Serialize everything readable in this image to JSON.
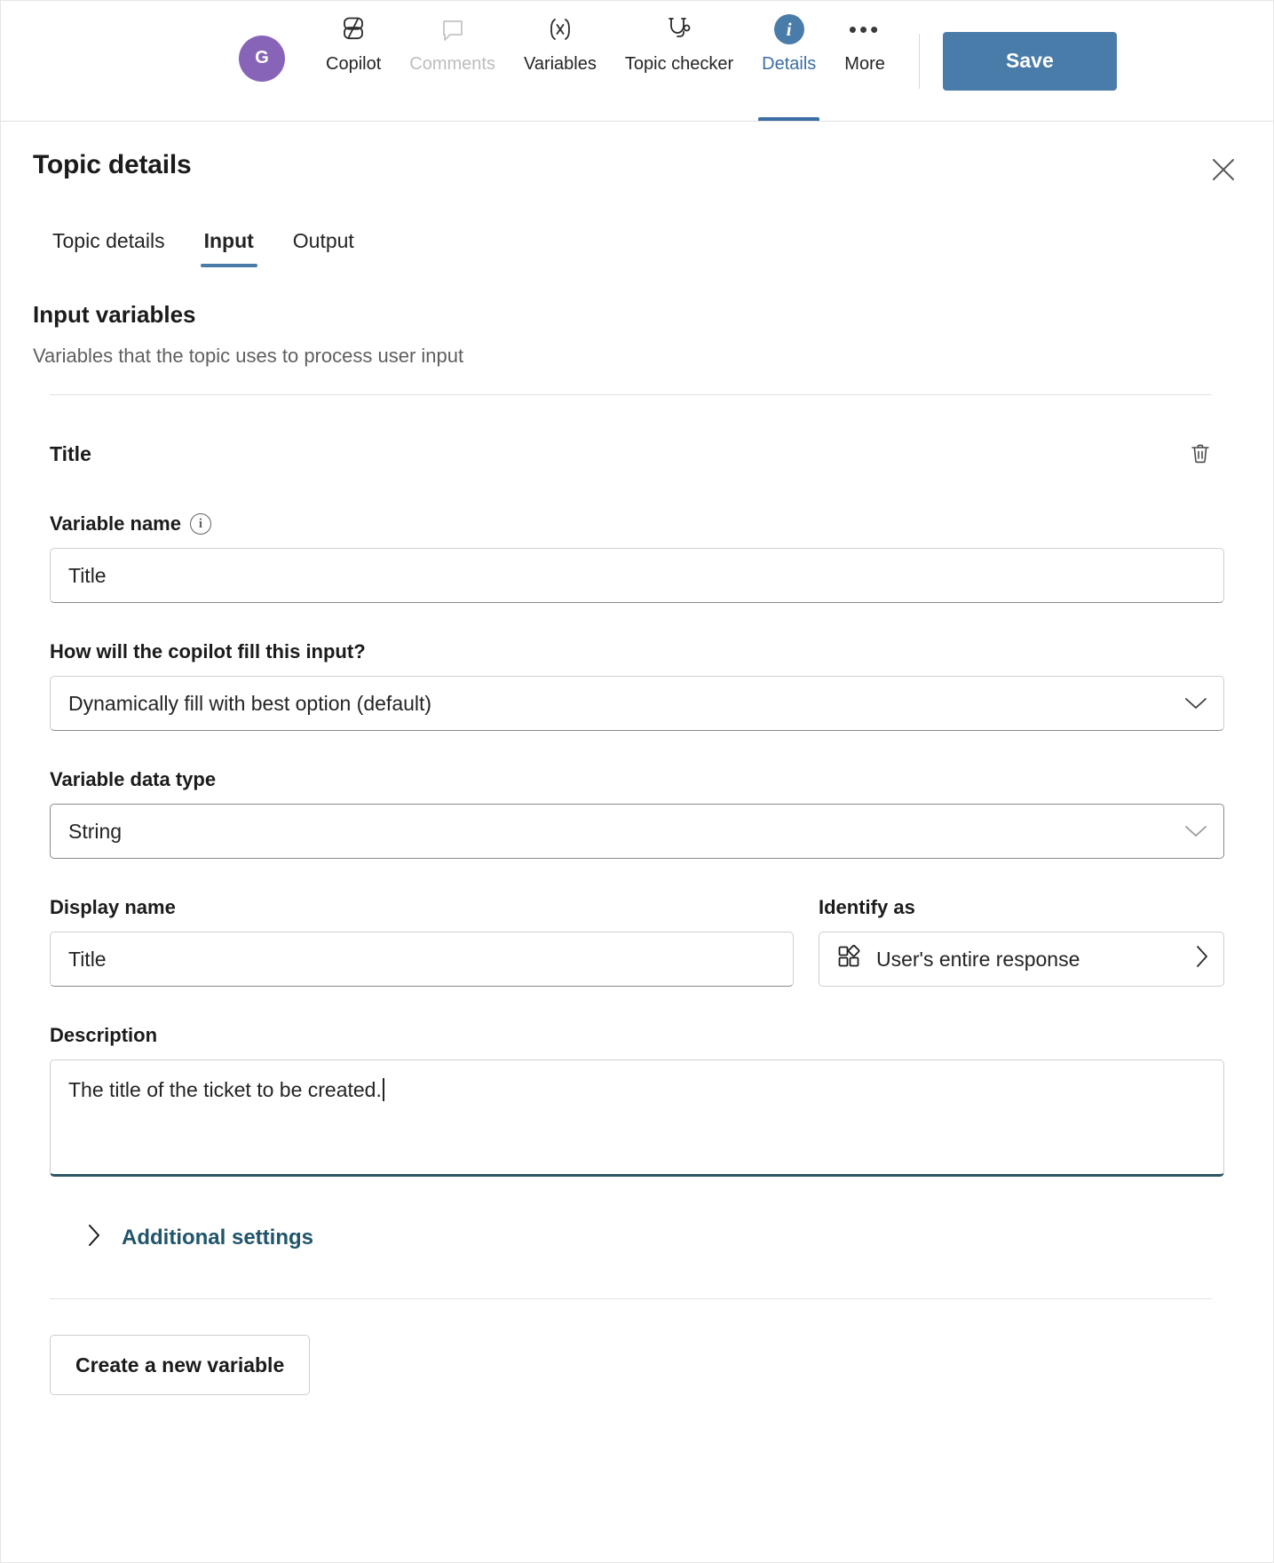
{
  "toolbar": {
    "avatar_initial": "G",
    "avatar_color": "#8764b8",
    "accent_color": "#4a7caa",
    "items": [
      {
        "label": "Copilot",
        "icon": "copilot-icon",
        "state": "normal"
      },
      {
        "label": "Comments",
        "icon": "comment-icon",
        "state": "disabled"
      },
      {
        "label": "Variables",
        "icon": "variables-icon",
        "state": "normal"
      },
      {
        "label": "Topic checker",
        "icon": "stethoscope-icon",
        "state": "normal"
      },
      {
        "label": "Details",
        "icon": "info-circle-icon",
        "state": "active"
      },
      {
        "label": "More",
        "icon": "ellipsis-icon",
        "state": "normal"
      }
    ],
    "save_label": "Save"
  },
  "panel": {
    "title": "Topic details",
    "close_label": "Close",
    "tabs": [
      {
        "label": "Topic details",
        "selected": false
      },
      {
        "label": "Input",
        "selected": true
      },
      {
        "label": "Output",
        "selected": false
      }
    ]
  },
  "section": {
    "heading": "Input variables",
    "subheading": "Variables that the topic uses to process user input"
  },
  "variable": {
    "name_header": "Title",
    "delete_tooltip": "Delete",
    "variable_name": {
      "label": "Variable name",
      "info_glyph": "i",
      "value": "Title"
    },
    "fill_mode": {
      "label": "How will the copilot fill this input?",
      "value": "Dynamically fill with best option (default)"
    },
    "data_type": {
      "label": "Variable data type",
      "value": "String"
    },
    "display_name": {
      "label": "Display name",
      "value": "Title"
    },
    "identify_as": {
      "label": "Identify as",
      "value": "User's entire response",
      "icon": "entity-icon"
    },
    "description": {
      "label": "Description",
      "value": "The title of the ticket to be created."
    },
    "additional_settings": {
      "label": "Additional settings",
      "expanded": false,
      "color": "#20556b"
    }
  },
  "footer": {
    "create_variable_label": "Create a new variable"
  }
}
